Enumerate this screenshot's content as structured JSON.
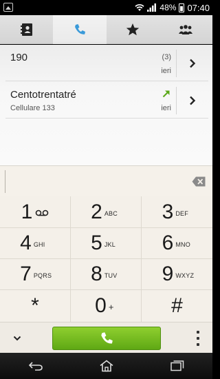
{
  "status_bar": {
    "battery_percent": "48%",
    "time": "07:40",
    "icons": [
      "picture-icon",
      "wifi-icon",
      "signal-icon",
      "battery-icon"
    ]
  },
  "tabs": [
    {
      "name": "contacts",
      "icon": "contacts-book-icon",
      "active": false
    },
    {
      "name": "phone",
      "icon": "phone-icon",
      "active": true
    },
    {
      "name": "favorites",
      "icon": "star-icon",
      "active": false
    },
    {
      "name": "groups",
      "icon": "groups-icon",
      "active": false
    }
  ],
  "call_log": [
    {
      "name": "190",
      "subtitle": "",
      "count": "(3)",
      "time": "ieri",
      "direction_icon": ""
    },
    {
      "name": "Centotrentatré",
      "subtitle": "Cellulare 133",
      "count": "",
      "time": "ieri",
      "direction_icon": "outgoing-call-arrow-icon"
    }
  ],
  "dial_input": {
    "value": ""
  },
  "keypad": [
    {
      "digit": "1",
      "letters": "",
      "icon": "voicemail-icon"
    },
    {
      "digit": "2",
      "letters": "ABC"
    },
    {
      "digit": "3",
      "letters": "DEF"
    },
    {
      "digit": "4",
      "letters": "GHI"
    },
    {
      "digit": "5",
      "letters": "JKL"
    },
    {
      "digit": "6",
      "letters": "MNO"
    },
    {
      "digit": "7",
      "letters": "PQRS"
    },
    {
      "digit": "8",
      "letters": "TUV"
    },
    {
      "digit": "9",
      "letters": "WXYZ"
    },
    {
      "digit": "*",
      "letters": ""
    },
    {
      "digit": "0",
      "letters": "+"
    },
    {
      "digit": "#",
      "letters": ""
    }
  ],
  "colors": {
    "accent_blue": "#3a9ad9",
    "call_green": "#6cb81c",
    "outgoing_arrow_green": "#5aa818"
  }
}
